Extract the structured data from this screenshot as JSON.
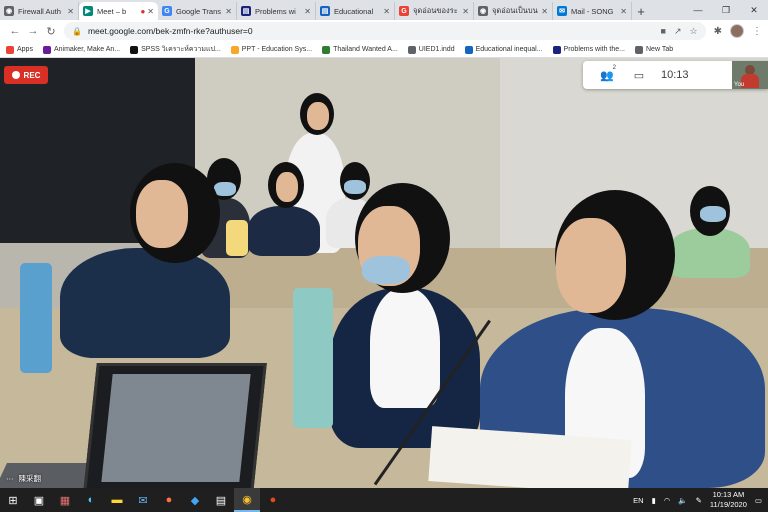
{
  "browser": {
    "tabs": [
      {
        "title": "Firewall Auth",
        "icon": "globe-icon",
        "color": "#5f6368",
        "active": false
      },
      {
        "title": "Meet – b",
        "icon": "meet-icon",
        "color": "#00897b",
        "active": true
      },
      {
        "title": "Google Trans",
        "icon": "translate-icon",
        "color": "#4285f4",
        "active": false
      },
      {
        "title": "Problems wi",
        "icon": "doc-icon",
        "color": "#1a237e",
        "active": false
      },
      {
        "title": "Educational",
        "icon": "doc-icon",
        "color": "#1565c0",
        "active": false
      },
      {
        "title": "จุดอ่อนของระ",
        "icon": "google-icon",
        "color": "#ea4335",
        "active": false
      },
      {
        "title": "จุดอ่อนเป็นบน",
        "icon": "globe-icon",
        "color": "#5f6368",
        "active": false
      },
      {
        "title": "Mail - SONG",
        "icon": "mail-icon",
        "color": "#0078d4",
        "active": false
      }
    ],
    "new_tab_glyph": "+",
    "url": "meet.google.com/bek-zmfn-rke?authuser=0",
    "bookmarks": [
      {
        "label": "Apps",
        "color": "#ea4335"
      },
      {
        "label": "Animaker, Make An...",
        "color": "#6a1b9a"
      },
      {
        "label": "SPSS วิเคราะห์ความแป...",
        "color": "#111111"
      },
      {
        "label": "PPT - Education Sys...",
        "color": "#f9a825"
      },
      {
        "label": "Thailand Wanted A...",
        "color": "#2e7d32"
      },
      {
        "label": "UIED1.indd",
        "color": "#5f6368"
      },
      {
        "label": "Educational inequal...",
        "color": "#1565c0"
      },
      {
        "label": "Problems with the...",
        "color": "#1a237e"
      },
      {
        "label": "New Tab",
        "color": "#5f6368"
      }
    ]
  },
  "meet": {
    "rec_label": "REC",
    "participants_count": "2",
    "clock": "10:13",
    "self_label": "You",
    "speaker_name": "陳采翻"
  },
  "taskbar": {
    "lang": "EN",
    "time": "10:13 AM",
    "date": "11/19/2020"
  }
}
